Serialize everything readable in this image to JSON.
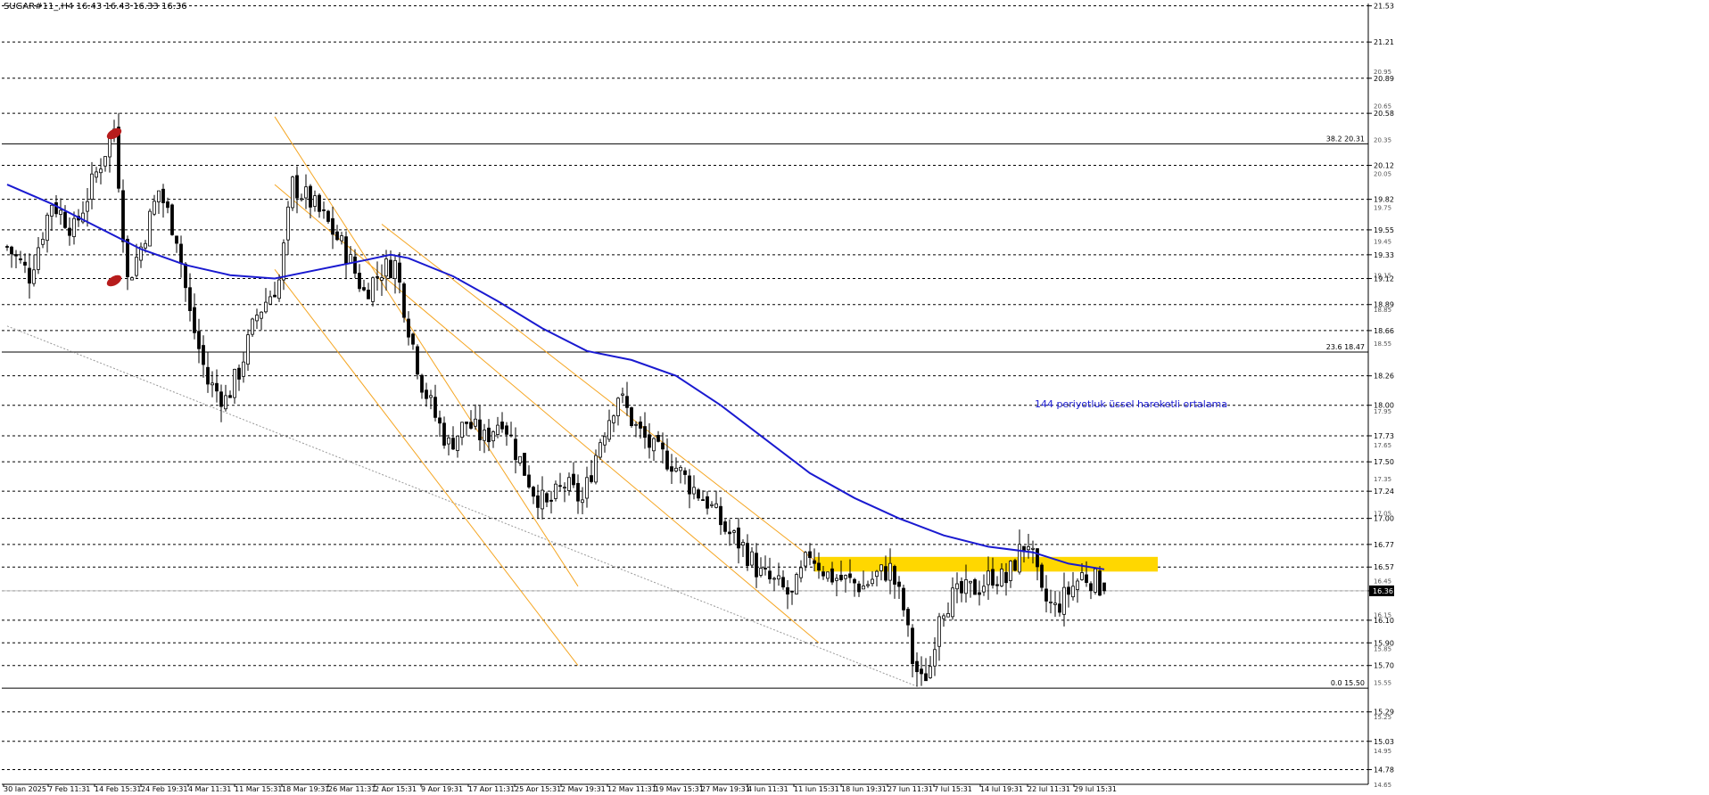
{
  "header": {
    "title": "SUGAR#11_,H4  16.43 16.43 16.33 16.36"
  },
  "annotation_text": "144 periyotluk üssel hareketli ortalama",
  "colors": {
    "background": "#ffffff",
    "grid": "#000000",
    "candles": "#000000",
    "ema": "#1a1ad0",
    "channel": "#f5a623",
    "zone": "#ffd700",
    "markers": "#b71c1c",
    "trendline": "#999999"
  },
  "chart_data": {
    "type": "candlestick",
    "symbol": "SUGAR#11_",
    "timeframe": "H4",
    "last_ohlc": {
      "open": 16.43,
      "high": 16.43,
      "low": 16.33,
      "close": 16.36
    },
    "ylim": [
      14.65,
      21.55
    ],
    "y_levels": [
      21.53,
      21.21,
      20.89,
      20.58,
      20.12,
      19.82,
      19.55,
      19.33,
      19.12,
      18.89,
      18.66,
      18.26,
      18.0,
      17.73,
      17.5,
      17.24,
      17.0,
      16.77,
      16.57,
      16.36,
      16.1,
      15.9,
      15.7,
      15.29,
      15.03,
      14.78
    ],
    "y_minor_ticks": [
      20.95,
      20.65,
      20.35,
      20.05,
      19.75,
      19.45,
      19.15,
      18.85,
      18.55,
      17.95,
      17.65,
      17.35,
      17.05,
      16.45,
      16.15,
      15.85,
      15.55,
      15.25,
      14.95,
      14.65
    ],
    "fibonacci": [
      {
        "label": "38.2",
        "value": 20.31
      },
      {
        "label": "23.6",
        "value": 18.47
      },
      {
        "label": "0.0",
        "value": 15.5
      }
    ],
    "current_price": 16.36,
    "x_labels": [
      "30 Jan 2025",
      "7 Feb 11:31",
      "14 Feb 15:31",
      "24 Feb 19:31",
      "4 Mar 11:31",
      "11 Mar 15:31",
      "18 Mar 19:31",
      "26 Mar 11:31",
      "2 Apr 15:31",
      "9 Apr 19:31",
      "17 Apr 11:31",
      "25 Apr 15:31",
      "2 May 19:31",
      "12 May 11:31",
      "19 May 15:31",
      "27 May 19:31",
      "4 Jun 11:31",
      "11 Jun 15:31",
      "18 Jun 19:31",
      "27 Jun 11:31",
      "7 Jul 15:31",
      "14 Jul 19:31",
      "22 Jul 11:31",
      "29 Jul 15:31"
    ],
    "close_anchors": [
      [
        0,
        19.4
      ],
      [
        5,
        19.15
      ],
      [
        10,
        19.8
      ],
      [
        15,
        19.55
      ],
      [
        20,
        20.05
      ],
      [
        24,
        20.45
      ],
      [
        27,
        19.1
      ],
      [
        30,
        19.4
      ],
      [
        34,
        19.9
      ],
      [
        38,
        19.5
      ],
      [
        41,
        18.8
      ],
      [
        45,
        18.2
      ],
      [
        49,
        18.05
      ],
      [
        52,
        18.3
      ],
      [
        56,
        18.8
      ],
      [
        61,
        19.1
      ],
      [
        64,
        19.95
      ],
      [
        68,
        19.8
      ],
      [
        72,
        19.6
      ],
      [
        76,
        19.35
      ],
      [
        80,
        19.0
      ],
      [
        84,
        19.2
      ],
      [
        87,
        19.25
      ],
      [
        90,
        18.7
      ],
      [
        93,
        18.2
      ],
      [
        96,
        17.9
      ],
      [
        99,
        17.65
      ],
      [
        103,
        17.85
      ],
      [
        107,
        17.7
      ],
      [
        111,
        17.9
      ],
      [
        114,
        17.6
      ],
      [
        118,
        17.25
      ],
      [
        121,
        17.1
      ],
      [
        125,
        17.3
      ],
      [
        129,
        17.15
      ],
      [
        133,
        17.7
      ],
      [
        137,
        18.1
      ],
      [
        141,
        17.8
      ],
      [
        145,
        17.6
      ],
      [
        149,
        17.5
      ],
      [
        153,
        17.3
      ],
      [
        157,
        17.15
      ],
      [
        161,
        16.9
      ],
      [
        165,
        16.75
      ],
      [
        169,
        16.5
      ],
      [
        173,
        16.4
      ],
      [
        176,
        16.3
      ],
      [
        180,
        16.7
      ],
      [
        184,
        16.5
      ],
      [
        188,
        16.45
      ],
      [
        192,
        16.4
      ],
      [
        195,
        16.5
      ],
      [
        198,
        16.55
      ],
      [
        201,
        16.2
      ],
      [
        203,
        15.75
      ],
      [
        205,
        15.55
      ],
      [
        207,
        15.7
      ],
      [
        209,
        16.2
      ],
      [
        212,
        16.3
      ],
      [
        215,
        16.35
      ],
      [
        218,
        16.4
      ],
      [
        221,
        16.5
      ],
      [
        224,
        16.45
      ],
      [
        227,
        16.7
      ],
      [
        229,
        16.8
      ],
      [
        232,
        16.3
      ],
      [
        235,
        16.2
      ],
      [
        238,
        16.35
      ],
      [
        241,
        16.5
      ],
      [
        244,
        16.45
      ],
      [
        246,
        16.36
      ]
    ],
    "ema_144": [
      [
        0,
        19.95
      ],
      [
        10,
        19.78
      ],
      [
        20,
        19.58
      ],
      [
        30,
        19.38
      ],
      [
        40,
        19.24
      ],
      [
        50,
        19.15
      ],
      [
        60,
        19.12
      ],
      [
        70,
        19.2
      ],
      [
        80,
        19.28
      ],
      [
        86,
        19.33
      ],
      [
        90,
        19.3
      ],
      [
        100,
        19.14
      ],
      [
        110,
        18.92
      ],
      [
        120,
        18.68
      ],
      [
        130,
        18.48
      ],
      [
        140,
        18.4
      ],
      [
        150,
        18.26
      ],
      [
        160,
        18.0
      ],
      [
        170,
        17.7
      ],
      [
        180,
        17.4
      ],
      [
        190,
        17.18
      ],
      [
        200,
        17.0
      ],
      [
        210,
        16.85
      ],
      [
        220,
        16.75
      ],
      [
        230,
        16.7
      ],
      [
        238,
        16.6
      ],
      [
        246,
        16.55
      ]
    ],
    "channels": [
      {
        "from": [
          60,
          20.55
        ],
        "to": [
          128,
          16.4
        ]
      },
      {
        "from": [
          60,
          19.2
        ],
        "to": [
          128,
          15.7
        ]
      },
      {
        "from": [
          84,
          19.6
        ],
        "to": [
          182,
          16.6
        ]
      },
      {
        "from": [
          60,
          19.95
        ],
        "to": [
          182,
          15.9
        ]
      }
    ],
    "trendline": {
      "from": [
        0,
        18.7
      ],
      "to": [
        205,
        15.5
      ]
    },
    "resistance_zone": {
      "x_from": 181,
      "x_to": 258,
      "y_low": 16.53,
      "y_high": 16.66
    },
    "markers": [
      {
        "x": 22,
        "y": 20.4
      },
      {
        "x": 22,
        "y": 19.1
      }
    ]
  }
}
